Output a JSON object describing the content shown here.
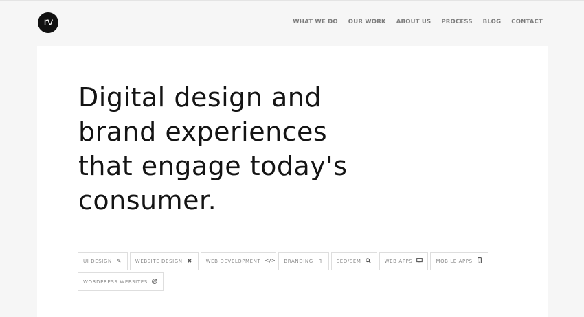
{
  "header": {
    "logo_text": "rv",
    "nav": [
      {
        "label": "WHAT WE DO",
        "name": "nav-what-we-do"
      },
      {
        "label": "OUR WORK",
        "name": "nav-our-work"
      },
      {
        "label": "ABOUT US",
        "name": "nav-about-us"
      },
      {
        "label": "PROCESS",
        "name": "nav-process"
      },
      {
        "label": "BLOG",
        "name": "nav-blog"
      },
      {
        "label": "CONTACT",
        "name": "nav-contact"
      }
    ]
  },
  "hero": {
    "headline_lines": [
      "Digital design and",
      "brand experiences",
      "that engage today's",
      "consumer."
    ]
  },
  "tags": [
    {
      "label": "UI DESIGN",
      "icon": "pencil-icon"
    },
    {
      "label": "WEBSITE DESIGN",
      "icon": "tools-icon"
    },
    {
      "label": "WEB DEVELOPMENT",
      "icon": "code-icon"
    },
    {
      "label": "BRANDING",
      "icon": "book-icon"
    },
    {
      "label": "SEO/SEM",
      "icon": "search-icon"
    },
    {
      "label": "WEB APPS",
      "icon": "desktop-icon"
    },
    {
      "label": "MOBILE APPS",
      "icon": "mobile-icon"
    },
    {
      "label": "WORDPRESS WEBSITES",
      "icon": "wordpress-icon"
    }
  ]
}
